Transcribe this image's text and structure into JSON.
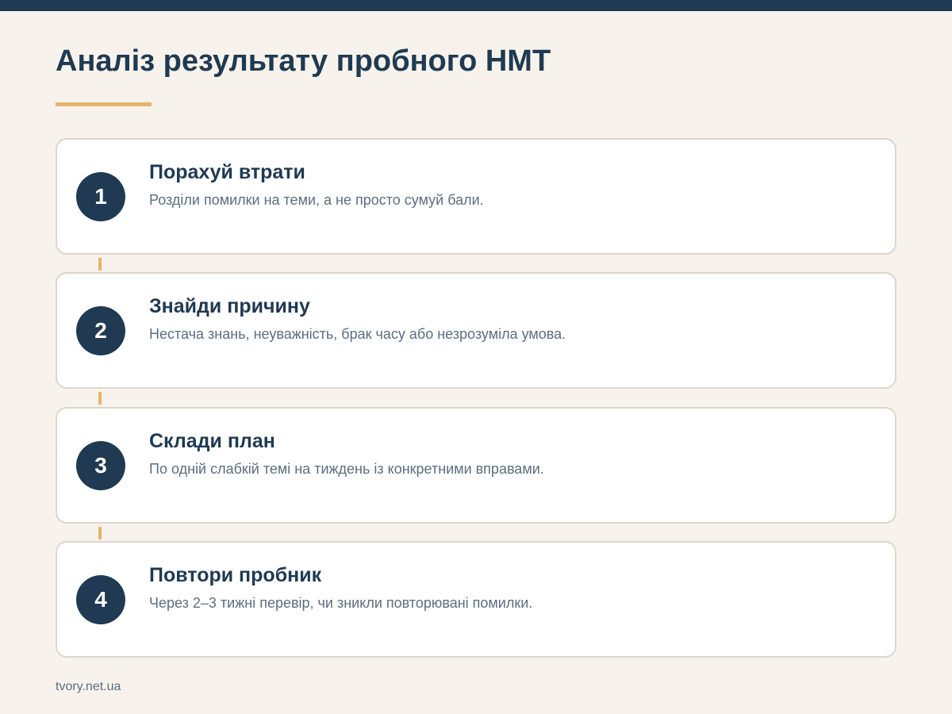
{
  "header": {
    "title": "Аналіз результату пробного НМТ"
  },
  "steps": [
    {
      "number": "1",
      "title": "Порахуй втрати",
      "description": "Розділи помилки на теми, а не просто сумуй бали."
    },
    {
      "number": "2",
      "title": "Знайди причину",
      "description": "Нестача знань, неуважність, брак часу або незрозуміла умова."
    },
    {
      "number": "3",
      "title": "Склади план",
      "description": "По одній слабкій темі на тиждень із конкретними вправами."
    },
    {
      "number": "4",
      "title": "Повтори пробник",
      "description": "Через 2–3 тижні перевір, чи зникли повторювані помилки."
    }
  ],
  "footer": {
    "source": "tvory.net.ua"
  },
  "colors": {
    "primary": "#1f3a52",
    "accent": "#e8b36a",
    "background": "#f7f3ec",
    "card_border": "#ddd6ca"
  }
}
